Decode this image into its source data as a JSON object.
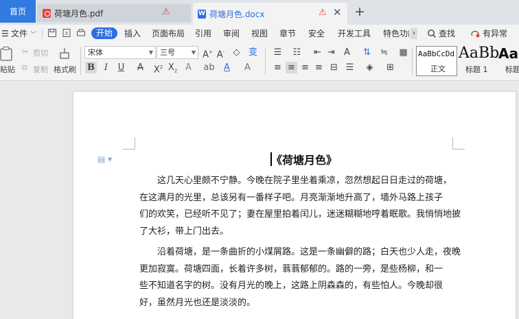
{
  "tabs": {
    "home": "首页",
    "pdf": "荷塘月色.pdf",
    "docx": "荷塘月色.docx",
    "docx_icon": "W",
    "warning_glyph": "⚠",
    "close_glyph": "✕",
    "add_glyph": "+"
  },
  "menu": {
    "file": "文件",
    "items": [
      "开始",
      "插入",
      "页面布局",
      "引用",
      "审阅",
      "视图",
      "章节",
      "安全",
      "开发工具",
      "特色功能"
    ],
    "search": "查找",
    "sync": "有异常"
  },
  "ribbon": {
    "paste": "粘贴",
    "cut": "剪切",
    "copy": "复制",
    "format_painter": "格式刷",
    "font_name": "宋体",
    "font_size": "三号",
    "styles": {
      "normal_sample": "AaBbCcDd",
      "normal_name": "正文",
      "h1_sample": "AaBb",
      "h1_name": "标题 1",
      "h2_sample": "AaB",
      "h2_name": "标题"
    }
  },
  "document": {
    "title": "《荷塘月色》",
    "paragraphs": [
      [
        "这几天心里颇不宁静。今晚在院子里坐着乘凉，忽然想起日日走过的荷塘，",
        "在这满月的光里，总该另有一番样子吧。月亮渐渐地升高了，墙外马路上孩子",
        "们的欢笑，已经听不见了；妻在屋里拍着闰儿，迷迷糊糊地哼着眠歌。我悄悄地披",
        "了大衫，带上门出去。"
      ],
      [
        "沿着荷塘，是一条曲折的小煤屑路。这是一条幽僻的路；白天也少人走，夜晚",
        "更加寂寞。荷塘四面，长着许多树，蓊蓊郁郁的。路的一旁，是些杨柳，和一",
        "些不知道名字的树。没有月光的晚上，这路上阴森森的，有些怕人。今晚却很",
        "好，虽然月光也还是淡淡的。"
      ]
    ]
  },
  "colors": {
    "accent": "#2f6ee0",
    "home_tab": "#2f7be0",
    "warning": "#e0453c"
  }
}
